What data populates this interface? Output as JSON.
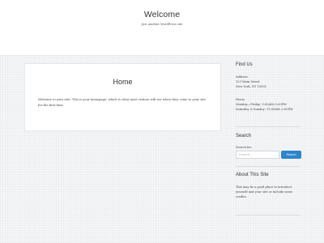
{
  "header": {
    "site_title": "Welcome",
    "tagline": "Just another WordPress site"
  },
  "main": {
    "page_title": "Home",
    "body_line1": "Welcome to your site! This is your homepage, which is what most visitors will see when they come to your",
    "body_line2": "site for the first time."
  },
  "sidebar": {
    "find_us": {
      "title": "Find Us",
      "address_label": "Address",
      "address_line1": "123 Main Street",
      "address_line2": "New York, NY 10001",
      "hours_label": "Hours",
      "hours_line1": "Monday—Friday: 9:00AM–5:00PM",
      "hours_line2": "Saturday & Sunday: 11:00AM–3:00PM"
    },
    "search": {
      "title": "Search",
      "label": "Search for:",
      "placeholder": "Search …",
      "button_label": "Search"
    },
    "about": {
      "title": "About This Site",
      "line1": "This may be a good place to introduce",
      "line2": "yourself and your site or include some",
      "line3": "credits."
    }
  }
}
